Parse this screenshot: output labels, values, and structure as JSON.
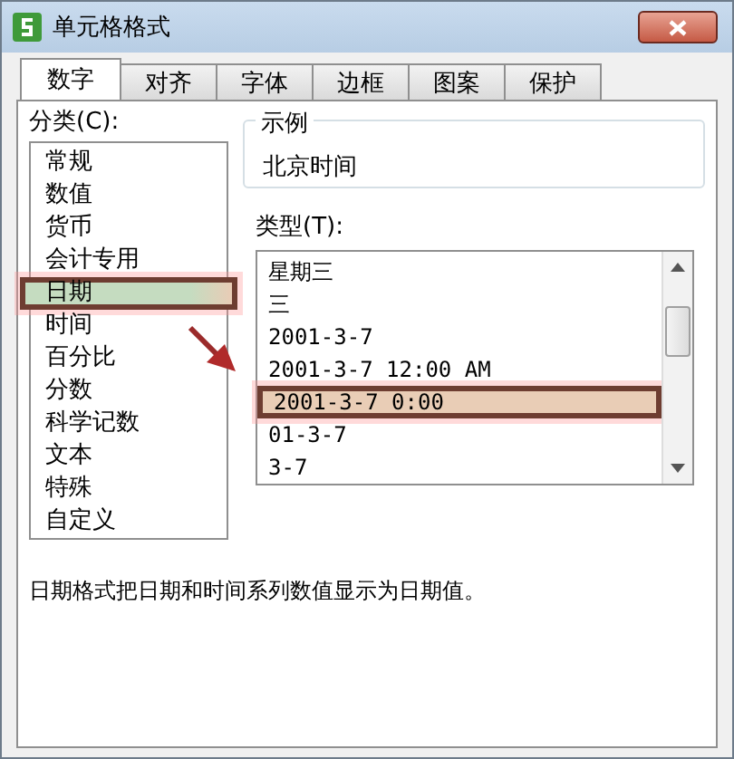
{
  "window": {
    "title": "单元格格式"
  },
  "tabs": [
    {
      "label": "数字",
      "selected": true
    },
    {
      "label": "对齐",
      "selected": false
    },
    {
      "label": "字体",
      "selected": false
    },
    {
      "label": "边框",
      "selected": false
    },
    {
      "label": "图案",
      "selected": false
    },
    {
      "label": "保护",
      "selected": false
    }
  ],
  "category": {
    "label": "分类(C):",
    "items": [
      {
        "label": "常规",
        "selected": false
      },
      {
        "label": "数值",
        "selected": false
      },
      {
        "label": "货币",
        "selected": false
      },
      {
        "label": "会计专用",
        "selected": false
      },
      {
        "label": "日期",
        "selected": true
      },
      {
        "label": "时间",
        "selected": false
      },
      {
        "label": "百分比",
        "selected": false
      },
      {
        "label": "分数",
        "selected": false
      },
      {
        "label": "科学记数",
        "selected": false
      },
      {
        "label": "文本",
        "selected": false
      },
      {
        "label": "特殊",
        "selected": false
      },
      {
        "label": "自定义",
        "selected": false
      }
    ]
  },
  "sample": {
    "title": "示例",
    "value": "北京时间"
  },
  "type": {
    "label": "类型(T):",
    "items": [
      {
        "label": "星期三",
        "selected": false
      },
      {
        "label": "三",
        "selected": false
      },
      {
        "label": "2001-3-7",
        "selected": false
      },
      {
        "label": "2001-3-7 12:00 AM",
        "selected": false
      },
      {
        "label": "2001-3-7 0:00",
        "selected": true
      },
      {
        "label": "01-3-7",
        "selected": false
      },
      {
        "label": "3-7",
        "selected": false
      }
    ]
  },
  "description": "日期格式把日期和时间系列数值显示为日期值。"
}
